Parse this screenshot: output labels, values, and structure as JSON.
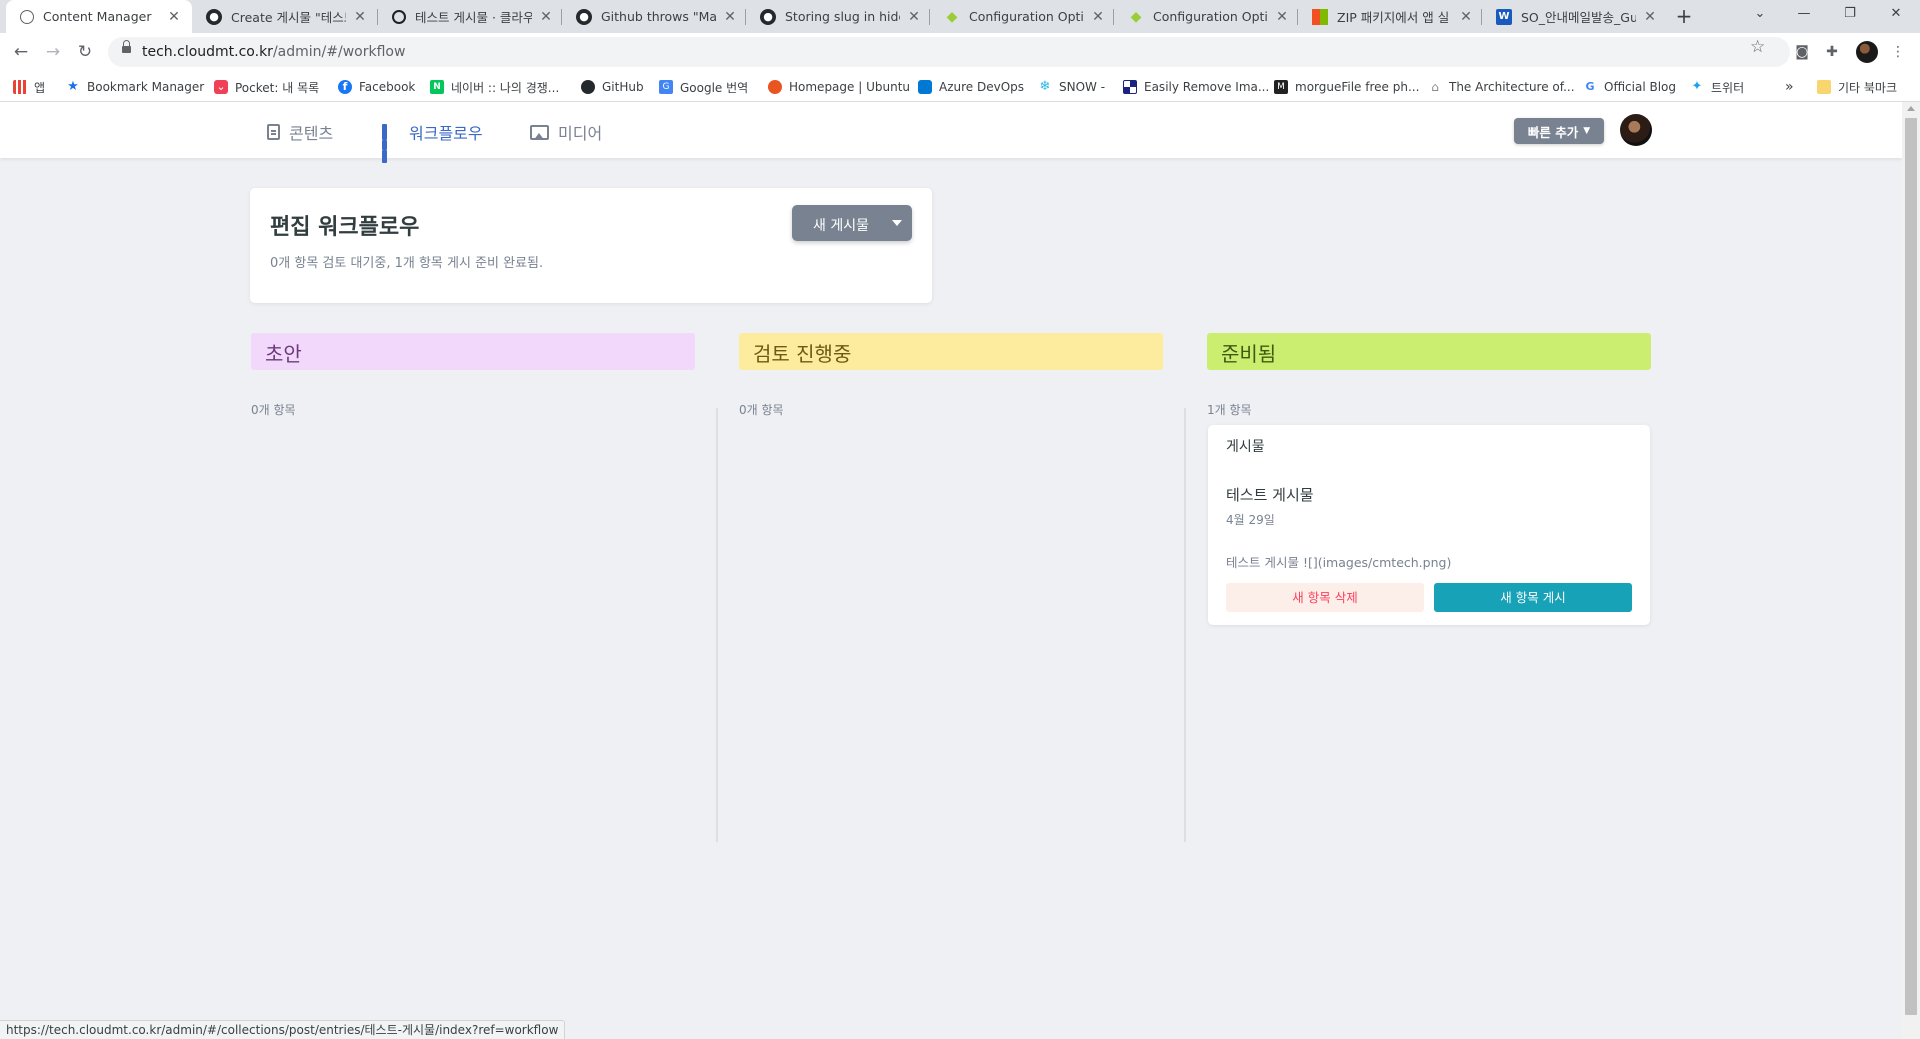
{
  "browser": {
    "tabs": [
      {
        "title": "Content Manager",
        "icon": "globe-icon",
        "active": true
      },
      {
        "title": "Create 게시물 \"테스트",
        "icon": "github-icon"
      },
      {
        "title": "테스트 게시물 · 클라우",
        "icon": "openai-icon"
      },
      {
        "title": "Github throws \"Malfor",
        "icon": "github-icon"
      },
      {
        "title": "Storing slug in hidden",
        "icon": "github-icon"
      },
      {
        "title": "Configuration Options",
        "icon": "diamond-icon"
      },
      {
        "title": "Configuration Options",
        "icon": "diamond-icon"
      },
      {
        "title": "ZIP 패키지에서 앱 실",
        "icon": "microsoft-icon"
      },
      {
        "title": "SO_안내메일발송_Gui",
        "icon": "word-icon"
      }
    ],
    "url_host": "tech.cloudmt.co.kr",
    "url_path": "/admin/#/workflow",
    "bookmarks": [
      {
        "label": "앱",
        "icon": "apps-grid-icon"
      },
      {
        "label": "Bookmark Manager",
        "icon": "star-icon"
      },
      {
        "label": "Pocket: 내 목록",
        "icon": "pocket-icon"
      },
      {
        "label": "Facebook",
        "icon": "facebook-icon"
      },
      {
        "label": "네이버 :: 나의 경쟁...",
        "icon": "naver-icon"
      },
      {
        "label": "GitHub",
        "icon": "github-icon"
      },
      {
        "label": "Google 번역",
        "icon": "translate-icon"
      },
      {
        "label": "Homepage | Ubuntu",
        "icon": "ubuntu-icon"
      },
      {
        "label": "Azure DevOps",
        "icon": "azure-devops-icon"
      },
      {
        "label": "SNOW -",
        "icon": "snowflake-icon"
      },
      {
        "label": "Easily Remove Ima...",
        "icon": "checker-icon"
      },
      {
        "label": "morgueFile free ph...",
        "icon": "morguefile-icon"
      },
      {
        "label": "The Architecture of...",
        "icon": "architecture-icon"
      },
      {
        "label": "Official Blog",
        "icon": "google-icon"
      },
      {
        "label": "트위터",
        "icon": "twitter-icon"
      }
    ],
    "bookmarks_overflow": "»",
    "other_bookmarks": "기타 북마크",
    "status_url": "https://tech.cloudmt.co.kr/admin/#/collections/post/entries/테스트-게시물/index?ref=workflow"
  },
  "app": {
    "nav": [
      {
        "label": "콘텐츠",
        "icon": "document-icon"
      },
      {
        "label": "워크플로우",
        "icon": "workflow-icon",
        "active": true
      },
      {
        "label": "미디어",
        "icon": "image-icon"
      }
    ],
    "quick_add": "빠른 추가",
    "summary": {
      "title": "편집 워크플로우",
      "description": "0개 항목 검토 대기중, 1개 항목 게시 준비 완료됨.",
      "new_post": "새 게시물"
    },
    "columns": [
      {
        "title": "초안",
        "count": "0개 항목",
        "color": "#f2d8fa"
      },
      {
        "title": "검토 진행중",
        "count": "0개 항목",
        "color": "#fdec9d"
      },
      {
        "title": "준비됨",
        "count": "1개 항목",
        "color": "#ccee70"
      }
    ],
    "entry": {
      "collection": "게시물",
      "title": "테스트 게시물",
      "date": "4월 29일",
      "body": "테스트 게시물 ![](images/cmtech.png)",
      "delete_label": "새 항목 삭제",
      "publish_label": "새 항목 게시"
    }
  }
}
